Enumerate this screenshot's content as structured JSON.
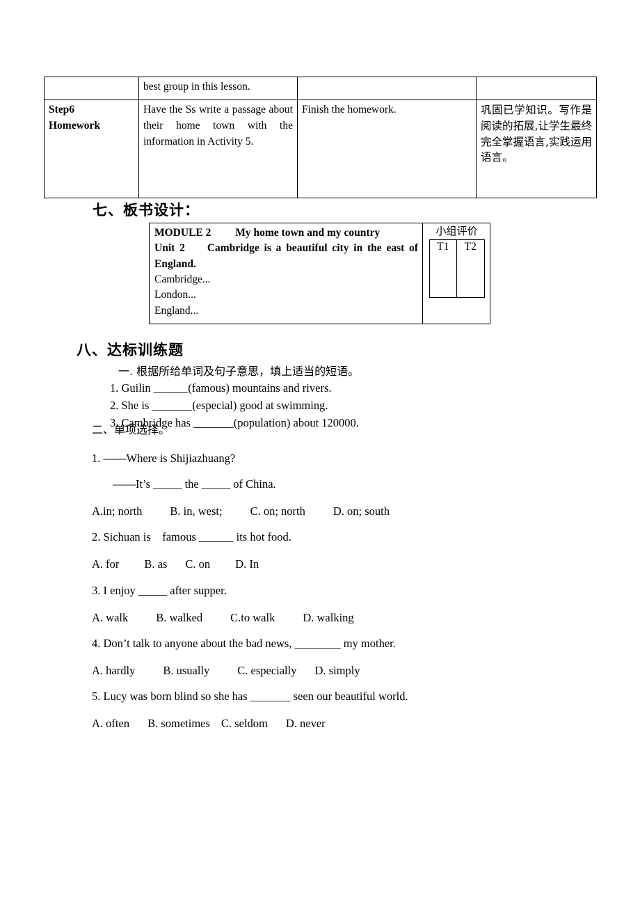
{
  "lesson_table": {
    "columns": [
      "step",
      "teaching_activity",
      "learning_activity",
      "design_intent"
    ],
    "rows": [
      {
        "step": "",
        "teaching_activity": "best group in this lesson.",
        "learning_activity": "",
        "design_intent": ""
      },
      {
        "step_line1": "Step6",
        "step_line2": "Homework",
        "teaching_activity": "Have the Ss write a passage about their home town with the information in Activity 5.",
        "learning_activity": "Finish the homework.",
        "design_intent": "巩固已学知识。写作是阅读的拓展,让学生最终完全掌握语言,实践运用语言。"
      }
    ]
  },
  "section_seven": {
    "heading": "七、板书设计：",
    "blackboard": {
      "line1": "MODULE 2 　　My home town and my country",
      "line2": "Unit 2 　 Cambridge is a beautiful city in the east of England.",
      "line3": "Cambridge...",
      "line4": "London...",
      "line5": "England...",
      "eval_title": "小组评价",
      "eval_cells": [
        "T1",
        "T2"
      ]
    }
  },
  "section_eight": {
    "heading": "八、达标训练题",
    "part_one": {
      "heading": "一. 根据所给单词及句子意思，填上适当的短语。",
      "items": [
        "1. Guilin ______(famous) mountains and rivers.",
        "2. She is _______(especial) good at swimming.",
        "3. Cambridge has _______(population) about 120000."
      ]
    },
    "part_two": {
      "heading": "二、单项选择。",
      "questions": [
        {
          "stem": "1. ——Where is Shijiazhuang?",
          "stem_sub": "——It’s _____ the _____ of China.",
          "options": [
            "A.in; north",
            "B. in, west;",
            "C. on; north",
            "D. on; south"
          ]
        },
        {
          "stem": "2. Sichuan is　famous ______ its hot food.",
          "options": [
            "A. for",
            "B. as",
            "C. on",
            "D. In"
          ]
        },
        {
          "stem": "3. I enjoy _____ after supper.",
          "options": [
            "A. walk",
            "B. walked",
            "C.to walk",
            "D. walking"
          ]
        },
        {
          "stem": "4. Don’t talk to anyone about the bad news, ________ my mother.",
          "options": [
            "A. hardly",
            "B. usually",
            "C. especially",
            "D. simply"
          ]
        },
        {
          "stem": "5. Lucy was born blind so she has _______ seen our beautiful world.",
          "options": [
            "A. often",
            "B. sometimes",
            "C. seldom",
            "D. never"
          ]
        }
      ]
    }
  }
}
